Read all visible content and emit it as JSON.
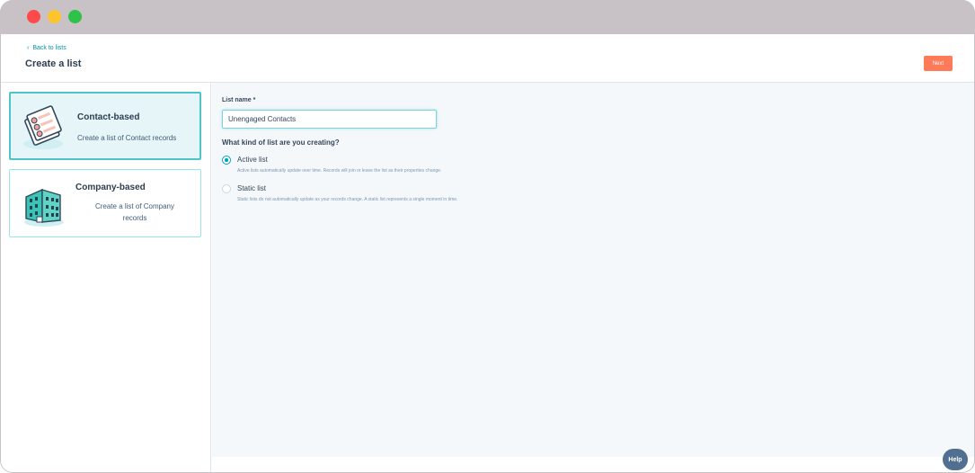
{
  "header": {
    "back_label": "Back to lists",
    "title": "Create a list",
    "next_label": "Next"
  },
  "cards": [
    {
      "title": "Contact-based",
      "description": "Create a list of Contact records",
      "selected": true,
      "icon": "contact-cards-icon"
    },
    {
      "title": "Company-based",
      "description": "Create a list of Company records",
      "selected": false,
      "icon": "company-building-icon"
    }
  ],
  "form": {
    "list_name_label": "List name *",
    "list_name_value": "Unengaged Contacts",
    "question": "What kind of list are you creating?",
    "options": [
      {
        "label": "Active list",
        "help": "Active lists automatically update over time. Records will join or leave the list as their properties change.",
        "checked": true
      },
      {
        "label": "Static list",
        "help": "Static lists do not automatically update as your records change. A static list represents a single moment in time.",
        "checked": false
      }
    ]
  },
  "help_label": "Help",
  "colors": {
    "accent": "#00a4bd",
    "primary_button": "#ff7a59",
    "selected_card_bg": "#e5f5f8",
    "window_chrome": "#c8c1c6"
  }
}
